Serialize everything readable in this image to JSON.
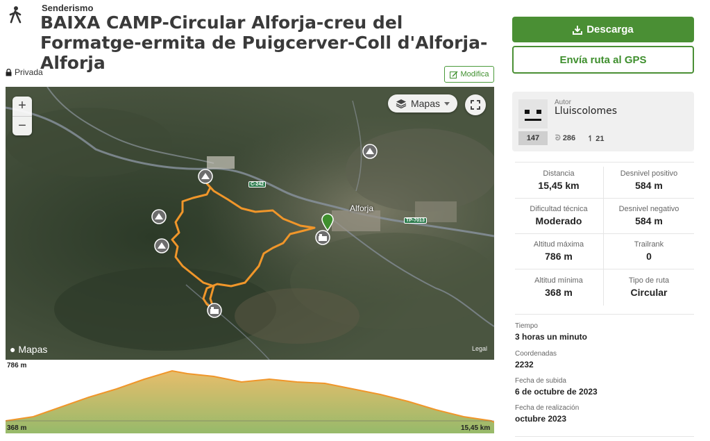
{
  "activity_type": "Senderismo",
  "title": "BAIXA CAMP-Circular Alforja-creu del Formatge-ermita de Puigcerver-Coll d'Alforja-Alforja",
  "privacy": "Privada",
  "edit_label": "Modifica",
  "map": {
    "zoom_in": "+",
    "zoom_out": "−",
    "type_selector": "Mapas",
    "provider": "Mapas",
    "legal": "Legal",
    "town": "Alforja",
    "roads": [
      "C-242",
      "TP-7013"
    ]
  },
  "elevation": {
    "max_label": "786 m",
    "min_label": "368 m",
    "distance_label": "15,45 km"
  },
  "actions": {
    "download": "Descarga",
    "send_gps": "Envía ruta al GPS"
  },
  "author": {
    "caption": "Autor",
    "name": "Lluiscolomes",
    "rank": "147",
    "followers": "286",
    "following": "21"
  },
  "stats": [
    {
      "label": "Distancia",
      "value": "15,45 km"
    },
    {
      "label": "Desnivel positivo",
      "value": "584 m"
    },
    {
      "label": "Dificultad técnica",
      "value": "Moderado"
    },
    {
      "label": "Desnivel negativo",
      "value": "584 m"
    },
    {
      "label": "Altitud máxima",
      "value": "786 m"
    },
    {
      "label": "Trailrank",
      "value": "0"
    },
    {
      "label": "Altitud mínima",
      "value": "368 m"
    },
    {
      "label": "Tipo de ruta",
      "value": "Circular"
    }
  ],
  "details": [
    {
      "label": "Tiempo",
      "value": "3 horas un minuto"
    },
    {
      "label": "Coordenadas",
      "value": "2232"
    },
    {
      "label": "Fecha de subida",
      "value": "6 de octubre de 2023"
    },
    {
      "label": "Fecha de realización",
      "value": "octubre 2023"
    }
  ],
  "colors": {
    "accent": "#4a8f34",
    "track": "#f0962a"
  }
}
